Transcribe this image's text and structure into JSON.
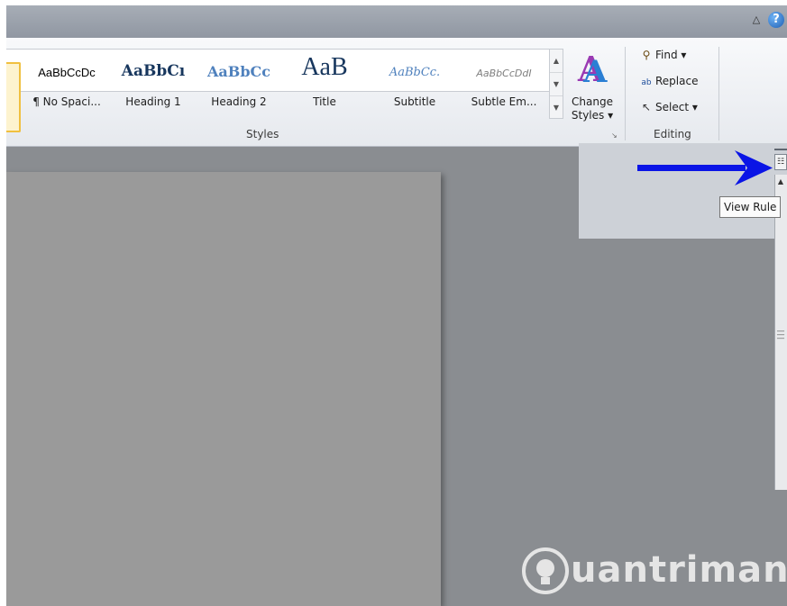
{
  "window": {
    "collapse_ribbon_glyph": "△",
    "help_glyph": "?"
  },
  "styles_gallery": {
    "items": [
      {
        "sample": "AaBbCcDc",
        "name": "¶ No Spaci..."
      },
      {
        "sample": "AaBbCı",
        "name": "Heading 1"
      },
      {
        "sample": "AaBbCc",
        "name": "Heading 2"
      },
      {
        "sample": "AaB",
        "name": "Title"
      },
      {
        "sample": "AaBbCc.",
        "name": "Subtitle"
      },
      {
        "sample": "AaBbCcDdI",
        "name": "Subtle Em..."
      }
    ],
    "group_label": "Styles"
  },
  "change_styles": {
    "label_line1": "Change",
    "label_line2": "Styles ▾"
  },
  "editing": {
    "find": "Find ▾",
    "replace": "Replace",
    "select": "Select ▾",
    "group_label": "Editing"
  },
  "tooltip": {
    "text": "View Rule"
  },
  "watermark": {
    "text": "uantrimang"
  },
  "colors": {
    "arrow": "#0a14e6",
    "ribbon_bg": "#eef0f4",
    "workspace": "#8a8d91"
  },
  "icons": [
    "collapse-ribbon-icon",
    "help-icon",
    "change-styles-icon",
    "binoculars-icon",
    "replace-icon",
    "cursor-icon",
    "view-ruler-icon",
    "scroll-up-icon",
    "lightbulb-icon"
  ]
}
